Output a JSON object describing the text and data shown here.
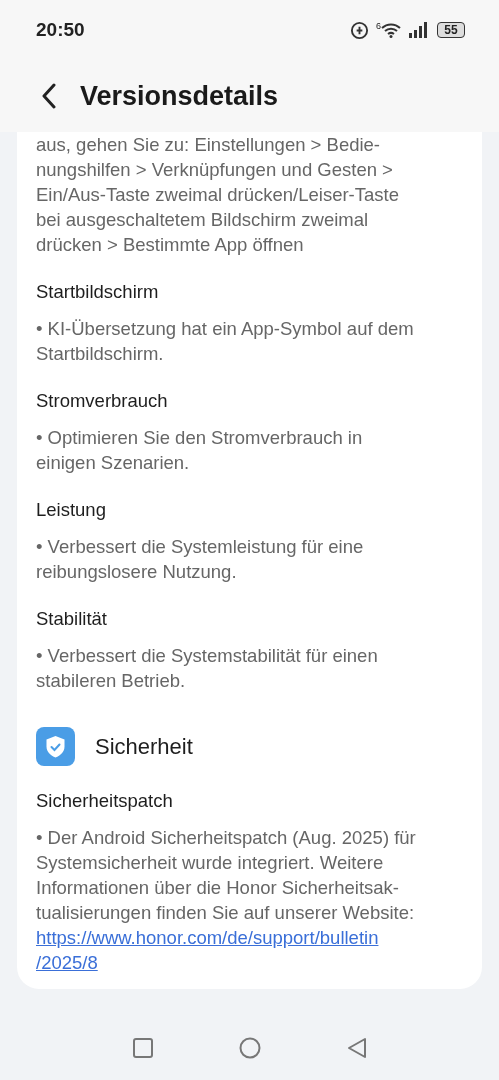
{
  "status_bar": {
    "time": "20:50",
    "wifi_badge": "6",
    "battery": "55"
  },
  "header": {
    "title": "Versionsdetails"
  },
  "intro": {
    "lines": [
      "aus, gehen Sie zu: Einstellungen > Bedie-",
      "nungshilfen > Verknüpfungen und Gesten >",
      "Ein/Aus-Taste zweimal drücken/Leiser-Taste",
      "bei ausgeschaltetem Bildschirm zweimal",
      "drücken > Bestimmte App öffnen"
    ]
  },
  "items": [
    {
      "heading": "Startbildschirm",
      "lines": [
        "• KI-Übersetzung hat ein App-Symbol auf dem",
        "Startbildschirm."
      ]
    },
    {
      "heading": "Stromverbrauch",
      "lines": [
        "• Optimieren Sie den Stromverbrauch in",
        "einigen Szenarien."
      ]
    },
    {
      "heading": "Leistung",
      "lines": [
        "• Verbessert die Systemleistung für eine",
        "reibungslosere Nutzung."
      ]
    },
    {
      "heading": "Stabilität",
      "lines": [
        "• Verbessert die Systemstabilität für einen",
        "stabileren Betrieb."
      ]
    }
  ],
  "security": {
    "title": "Sicherheit",
    "items": [
      {
        "heading": "Sicherheitspatch",
        "lines": [
          "• Der Android Sicherheitspatch (Aug. 2025) für",
          "Systemsicherheit wurde integriert. Weitere",
          "Informationen über die Honor Sicherheitsak-",
          "tualisierungen finden Sie auf unserer Website:"
        ],
        "link_lines": [
          "https://www.honor.com/de/support/bulletin",
          "/2025/8"
        ]
      }
    ]
  }
}
